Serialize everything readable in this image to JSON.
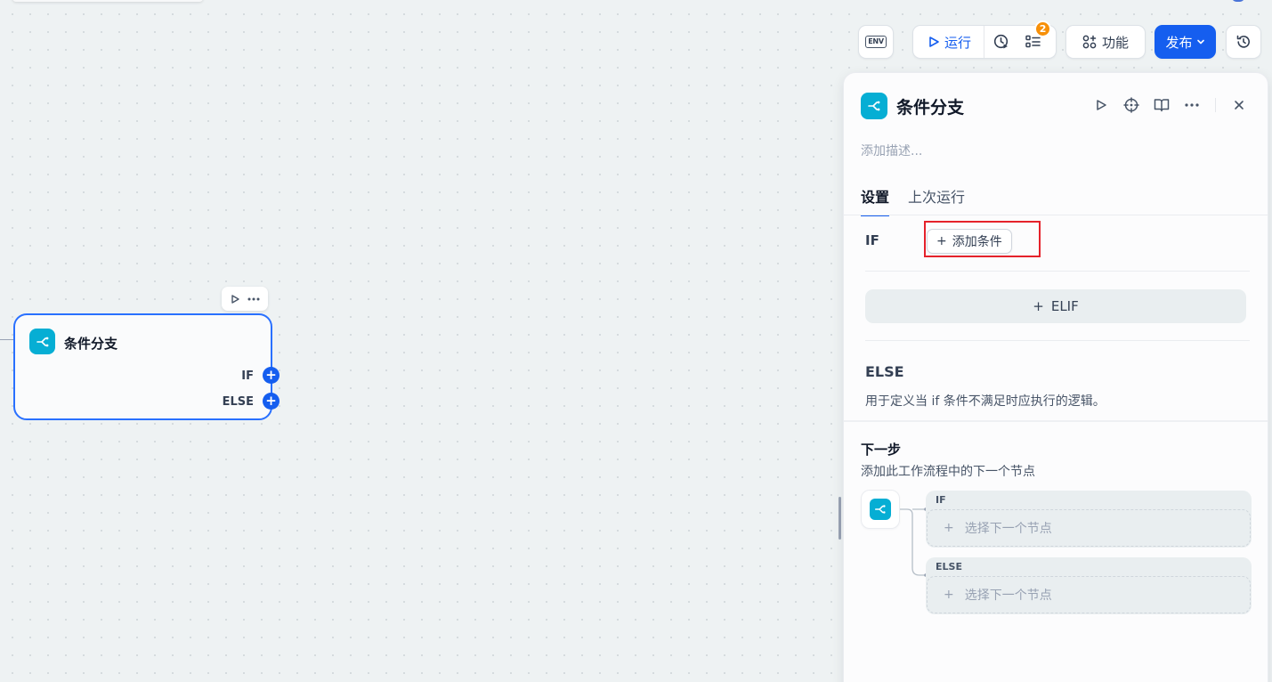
{
  "toolbar": {
    "env_label": "ENV",
    "run_label": "运行",
    "checklist_badge": "2",
    "features_label": "功能",
    "publish_label": "发布"
  },
  "node": {
    "title": "条件分支",
    "if_label": "IF",
    "else_label": "ELSE",
    "handle_symbol": "+"
  },
  "panel": {
    "title": "条件分支",
    "description_placeholder": "添加描述...",
    "tabs": [
      "设置",
      "上次运行"
    ],
    "if_label": "IF",
    "add_condition_label": "添加条件",
    "elif_label": "ELIF",
    "else_title": "ELSE",
    "else_description": "用于定义当 if 条件不满足时应执行的逻辑。",
    "next_step_title": "下一步",
    "next_step_description": "添加此工作流程中的下一个节点",
    "branches": [
      {
        "label": "IF",
        "placeholder": "选择下一个节点"
      },
      {
        "label": "ELSE",
        "placeholder": "选择下一个节点"
      }
    ],
    "plus_symbol": "+"
  },
  "colors": {
    "accent": "#155eef",
    "node_icon": "#06aed4",
    "badge": "#f79009",
    "highlight_box": "#e5222b"
  }
}
